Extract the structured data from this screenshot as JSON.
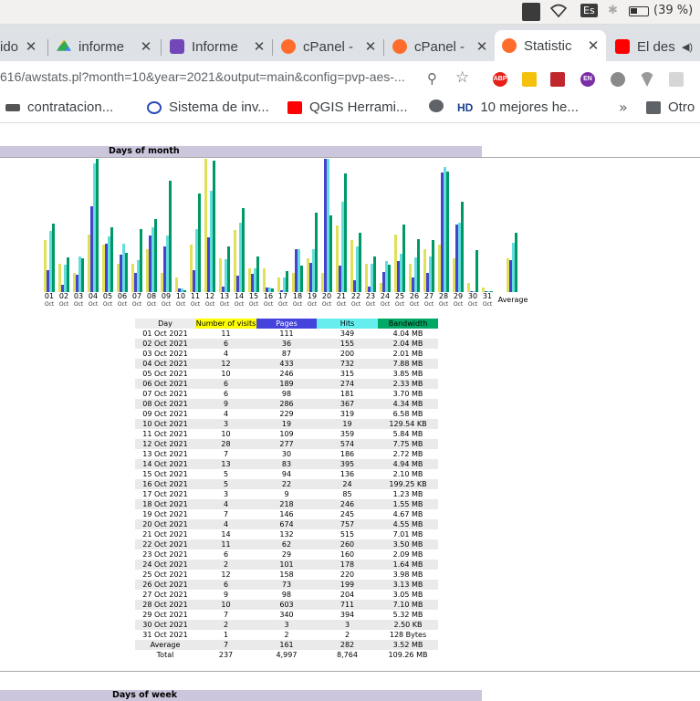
{
  "system_tray": {
    "keyboard_layout": "Es",
    "battery": "(39 %)",
    "icons": [
      "list-icon",
      "wifi-icon",
      "bluetooth-icon",
      "battery-icon"
    ]
  },
  "tabs": [
    {
      "label": "ido",
      "icon": "generic-tab-icon",
      "active": false
    },
    {
      "label": "informe",
      "icon": "google-drive-icon",
      "active": false
    },
    {
      "label": "Informe",
      "icon": "google-forms-icon",
      "active": false
    },
    {
      "label": "cPanel - ",
      "icon": "cpanel-icon",
      "active": false
    },
    {
      "label": "cPanel - ",
      "icon": "cpanel-icon",
      "active": false
    },
    {
      "label": "Statistic",
      "icon": "cpanel-icon",
      "active": true
    },
    {
      "label": "El des",
      "icon": "youtube-icon",
      "active": false
    }
  ],
  "address_bar": {
    "url": "616/awstats.pl?month=10&year=2021&output=main&config=pvp-aes-...",
    "extensions": [
      "ABP",
      "bookmark",
      "mendeley",
      "EN",
      "leaf",
      "vpn",
      "screenshot",
      "puzzle"
    ]
  },
  "bookmarks": [
    {
      "label": "contratacion..."
    },
    {
      "label": "Sistema de inv..."
    },
    {
      "label": "QGIS Herrami..."
    },
    {
      "label": ""
    },
    {
      "label": "10 mejores he..."
    },
    {
      "label": "Otro"
    }
  ],
  "sections": {
    "days_of_month": "Days of month",
    "days_of_week": "Days of week"
  },
  "chart_data": {
    "type": "bar",
    "categories": [
      "01",
      "02",
      "03",
      "04",
      "05",
      "06",
      "07",
      "08",
      "09",
      "10",
      "11",
      "12",
      "13",
      "14",
      "15",
      "16",
      "17",
      "18",
      "19",
      "20",
      "21",
      "22",
      "23",
      "24",
      "25",
      "26",
      "27",
      "28",
      "29",
      "30",
      "31",
      "Average"
    ],
    "sublabel": "Oct",
    "series": [
      {
        "name": "Number of visits",
        "color": "#e0e05a",
        "values": [
          11,
          6,
          4,
          12,
          10,
          6,
          6,
          9,
          4,
          3,
          10,
          28,
          7,
          13,
          5,
          5,
          3,
          4,
          7,
          4,
          14,
          11,
          6,
          2,
          12,
          6,
          9,
          10,
          7,
          2,
          1,
          7
        ]
      },
      {
        "name": "Pages",
        "color": "#4444cc",
        "values": [
          111,
          36,
          87,
          433,
          246,
          189,
          98,
          286,
          229,
          19,
          109,
          277,
          30,
          83,
          94,
          22,
          9,
          218,
          146,
          674,
          132,
          62,
          29,
          101,
          158,
          73,
          98,
          603,
          340,
          3,
          2,
          161
        ]
      },
      {
        "name": "Hits",
        "color": "#66dddd",
        "values": [
          349,
          155,
          200,
          732,
          315,
          274,
          181,
          367,
          319,
          19,
          359,
          574,
          186,
          395,
          136,
          24,
          85,
          246,
          245,
          757,
          515,
          260,
          160,
          178,
          220,
          199,
          204,
          711,
          394,
          3,
          2,
          282
        ]
      },
      {
        "name": "Bandwidth",
        "color": "#009966",
        "values": [
          4.04,
          2.04,
          2.01,
          7.88,
          3.85,
          2.33,
          3.7,
          4.34,
          6.58,
          0.1265,
          5.84,
          7.75,
          2.72,
          4.94,
          2.1,
          0.1946,
          1.23,
          1.55,
          4.67,
          4.55,
          7.01,
          3.5,
          2.09,
          1.64,
          3.98,
          3.13,
          3.05,
          7.1,
          5.32,
          2.5,
          0.000122,
          3.52
        ]
      }
    ],
    "legend_entries": [
      "Number of visits",
      "Pages",
      "Hits",
      "Bandwidth"
    ]
  },
  "table": {
    "headers": [
      "Day",
      "Number of visits",
      "Pages",
      "Hits",
      "Bandwidth"
    ],
    "header_colors": [
      "#ececec",
      "#ffff00",
      "#4444dd",
      "#66eeee",
      "#00aa66"
    ],
    "rows": [
      [
        "01 Oct 2021",
        "11",
        "111",
        "349",
        "4.04 MB"
      ],
      [
        "02 Oct 2021",
        "6",
        "36",
        "155",
        "2.04 MB"
      ],
      [
        "03 Oct 2021",
        "4",
        "87",
        "200",
        "2.01 MB"
      ],
      [
        "04 Oct 2021",
        "12",
        "433",
        "732",
        "7.88 MB"
      ],
      [
        "05 Oct 2021",
        "10",
        "246",
        "315",
        "3.85 MB"
      ],
      [
        "06 Oct 2021",
        "6",
        "189",
        "274",
        "2.33 MB"
      ],
      [
        "07 Oct 2021",
        "6",
        "98",
        "181",
        "3.70 MB"
      ],
      [
        "08 Oct 2021",
        "9",
        "286",
        "367",
        "4.34 MB"
      ],
      [
        "09 Oct 2021",
        "4",
        "229",
        "319",
        "6.58 MB"
      ],
      [
        "10 Oct 2021",
        "3",
        "19",
        "19",
        "129.54 KB"
      ],
      [
        "11 Oct 2021",
        "10",
        "109",
        "359",
        "5.84 MB"
      ],
      [
        "12 Oct 2021",
        "28",
        "277",
        "574",
        "7.75 MB"
      ],
      [
        "13 Oct 2021",
        "7",
        "30",
        "186",
        "2.72 MB"
      ],
      [
        "14 Oct 2021",
        "13",
        "83",
        "395",
        "4.94 MB"
      ],
      [
        "15 Oct 2021",
        "5",
        "94",
        "136",
        "2.10 MB"
      ],
      [
        "16 Oct 2021",
        "5",
        "22",
        "24",
        "199.25 KB"
      ],
      [
        "17 Oct 2021",
        "3",
        "9",
        "85",
        "1.23 MB"
      ],
      [
        "18 Oct 2021",
        "4",
        "218",
        "246",
        "1.55 MB"
      ],
      [
        "19 Oct 2021",
        "7",
        "146",
        "245",
        "4.67 MB"
      ],
      [
        "20 Oct 2021",
        "4",
        "674",
        "757",
        "4.55 MB"
      ],
      [
        "21 Oct 2021",
        "14",
        "132",
        "515",
        "7.01 MB"
      ],
      [
        "22 Oct 2021",
        "11",
        "62",
        "260",
        "3.50 MB"
      ],
      [
        "23 Oct 2021",
        "6",
        "29",
        "160",
        "2.09 MB"
      ],
      [
        "24 Oct 2021",
        "2",
        "101",
        "178",
        "1.64 MB"
      ],
      [
        "25 Oct 2021",
        "12",
        "158",
        "220",
        "3.98 MB"
      ],
      [
        "26 Oct 2021",
        "6",
        "73",
        "199",
        "3.13 MB"
      ],
      [
        "27 Oct 2021",
        "9",
        "98",
        "204",
        "3.05 MB"
      ],
      [
        "28 Oct 2021",
        "10",
        "603",
        "711",
        "7.10 MB"
      ],
      [
        "29 Oct 2021",
        "7",
        "340",
        "394",
        "5.32 MB"
      ],
      [
        "30 Oct 2021",
        "2",
        "3",
        "3",
        "2.50 KB"
      ],
      [
        "31 Oct 2021",
        "1",
        "2",
        "2",
        "128 Bytes"
      ],
      [
        "Average",
        "7",
        "161",
        "282",
        "3.52 MB"
      ],
      [
        "Total",
        "237",
        "4,997",
        "8,764",
        "109.26 MB"
      ]
    ]
  }
}
